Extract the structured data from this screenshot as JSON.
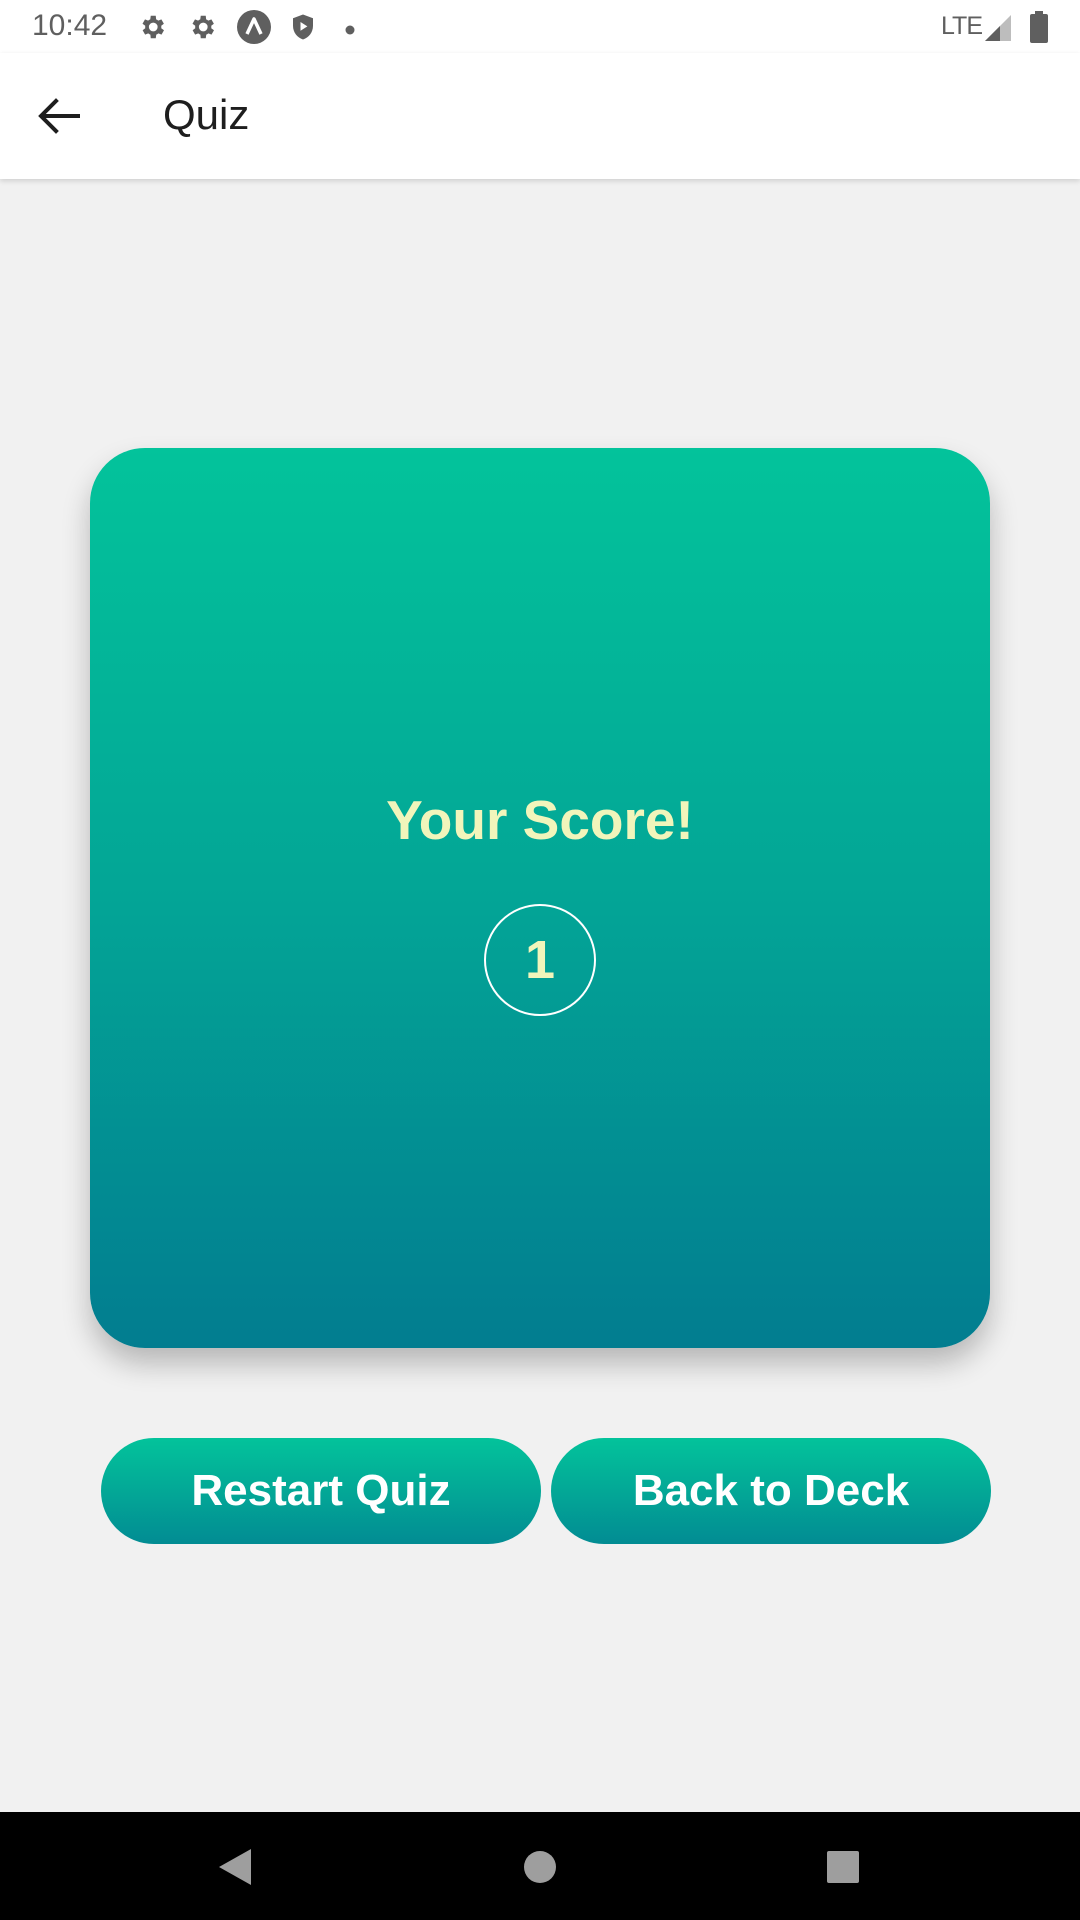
{
  "status_bar": {
    "time": "10:42",
    "network": "LTE",
    "icons": [
      "settings-icon",
      "settings-icon",
      "app-icon",
      "shield-icon",
      "notification-dot-icon",
      "signal-icon",
      "battery-icon"
    ]
  },
  "app_bar": {
    "title": "Quiz",
    "back_icon": "arrow-back-icon"
  },
  "score_card": {
    "title": "Your Score!",
    "score": "1"
  },
  "actions": {
    "restart_label": "Restart Quiz",
    "back_to_deck_label": "Back to Deck"
  },
  "nav_bar": {
    "items": [
      "back-triangle-icon",
      "home-circle-icon",
      "recents-square-icon"
    ]
  },
  "colors": {
    "gradient_top": "#03c39b",
    "gradient_bottom": "#027d90",
    "score_text": "#f1f5bb",
    "background": "#f1f1f1"
  }
}
